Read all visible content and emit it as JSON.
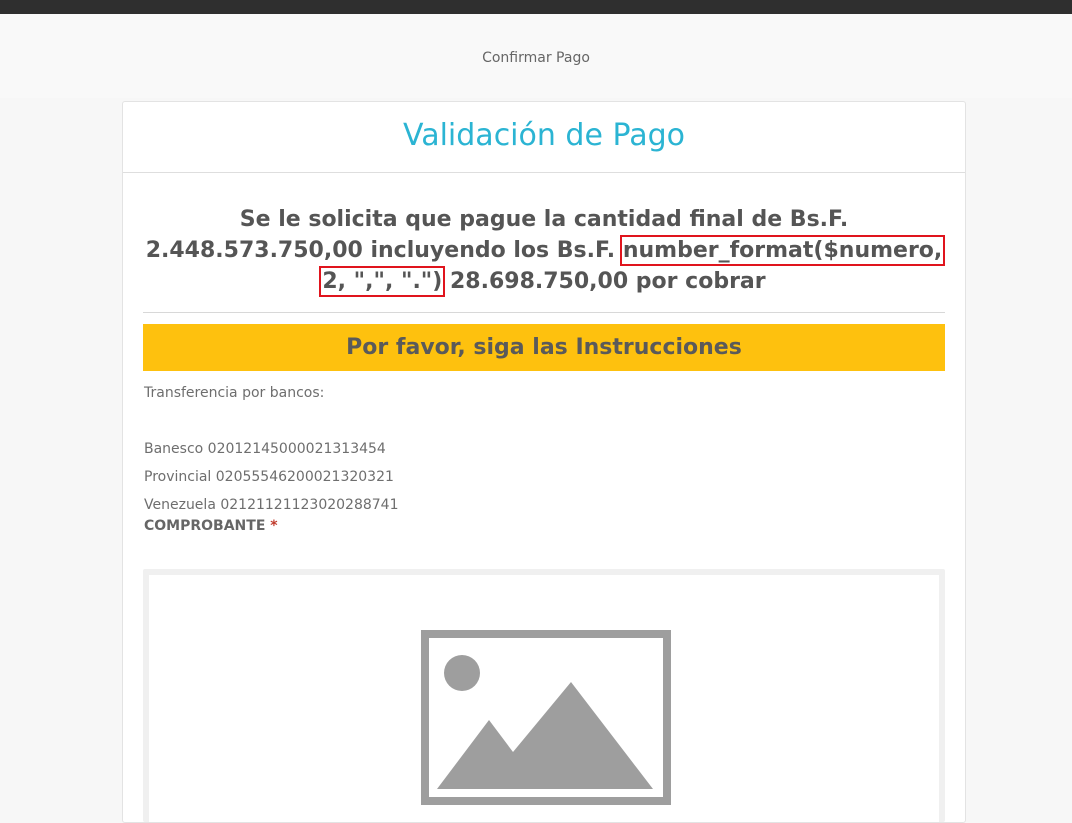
{
  "header": {
    "link_label": "Confirmar Pago"
  },
  "card": {
    "title": "Validación de Pago",
    "amount_prefix": "Se le solicita que pague la cantidad final de Bs.F. 2.448.573.750,00 incluyendo los Bs.F. ",
    "amount_code": "number_format($numero, 2, \",\", \".\")",
    "amount_suffix": " 28.698.750,00 por cobrar",
    "banner": "Por favor, siga las Instrucciones",
    "transfer_label": "Transferencia por bancos:",
    "banks": [
      "Banesco 02012145000021313454",
      "Provincial 02055546200021320321",
      "Venezuela 02121121123020288741"
    ],
    "comprobante_label": "COMPROBANTE",
    "required_mark": "*"
  },
  "icons": {
    "upload_placeholder": "image-placeholder-icon"
  },
  "colors": {
    "title": "#2bb4d3",
    "banner": "#fec10e",
    "highlight_box": "#e0141d",
    "topbar": "#2f2f2f"
  }
}
